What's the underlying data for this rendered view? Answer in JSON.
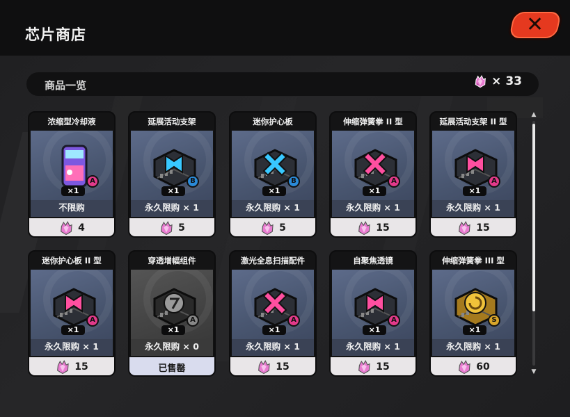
{
  "header": {
    "title": "芯片商店",
    "close_label": "✕"
  },
  "list_bar": {
    "label": "商品一览",
    "currency_icon": "crystal-currency-icon",
    "currency_count": "× 33"
  },
  "colors": {
    "close_red": "#e5391f",
    "grade_a": "#e23a8a",
    "grade_b": "#2a8ad8",
    "grade_s": "#d8a52a"
  },
  "items": [
    {
      "name": "浓缩型冷却液",
      "qty": "×1",
      "limit": "不限购",
      "price": "4",
      "grade": "A",
      "icon": "coolant-can-icon",
      "sold": false
    },
    {
      "name": "延展活动支架",
      "qty": "×1",
      "limit": "永久限购 × 1",
      "price": "5",
      "grade": "B",
      "icon": "chip-blue-bracket-icon",
      "sold": false
    },
    {
      "name": "迷你护心板",
      "qty": "×1",
      "limit": "永久限购 × 1",
      "price": "5",
      "grade": "B",
      "icon": "chip-blue-x-icon",
      "sold": false
    },
    {
      "name": "伸缩弹簧拳 II 型",
      "qty": "×1",
      "limit": "永久限购 × 1",
      "price": "15",
      "grade": "A",
      "icon": "chip-pink-x-icon",
      "sold": false
    },
    {
      "name": "延展活动支架 II 型",
      "qty": "×1",
      "limit": "永久限购 × 1",
      "price": "15",
      "grade": "A",
      "icon": "chip-pink-bracket-icon",
      "sold": false
    },
    {
      "name": "迷你护心板 II 型",
      "qty": "×1",
      "limit": "永久限购 × 1",
      "price": "15",
      "grade": "A",
      "icon": "chip-pink-bracket-icon",
      "sold": false
    },
    {
      "name": "穿透增幅组件",
      "qty": "×1",
      "limit": "永久限购 × 0",
      "price": "已售罄",
      "grade": "A",
      "icon": "chip-grey-icon",
      "sold": true
    },
    {
      "name": "激光全息扫描配件",
      "qty": "×1",
      "limit": "永久限购 × 1",
      "price": "15",
      "grade": "A",
      "icon": "chip-pink-x-icon",
      "sold": false
    },
    {
      "name": "自聚焦透镜",
      "qty": "×1",
      "limit": "永久限购 × 1",
      "price": "15",
      "grade": "A",
      "icon": "chip-pink-bracket-icon",
      "sold": false
    },
    {
      "name": "伸缩弹簧拳 III 型",
      "qty": "×1",
      "limit": "永久限购 × 1",
      "price": "60",
      "grade": "S",
      "icon": "chip-gold-spiral-icon",
      "sold": false
    }
  ]
}
